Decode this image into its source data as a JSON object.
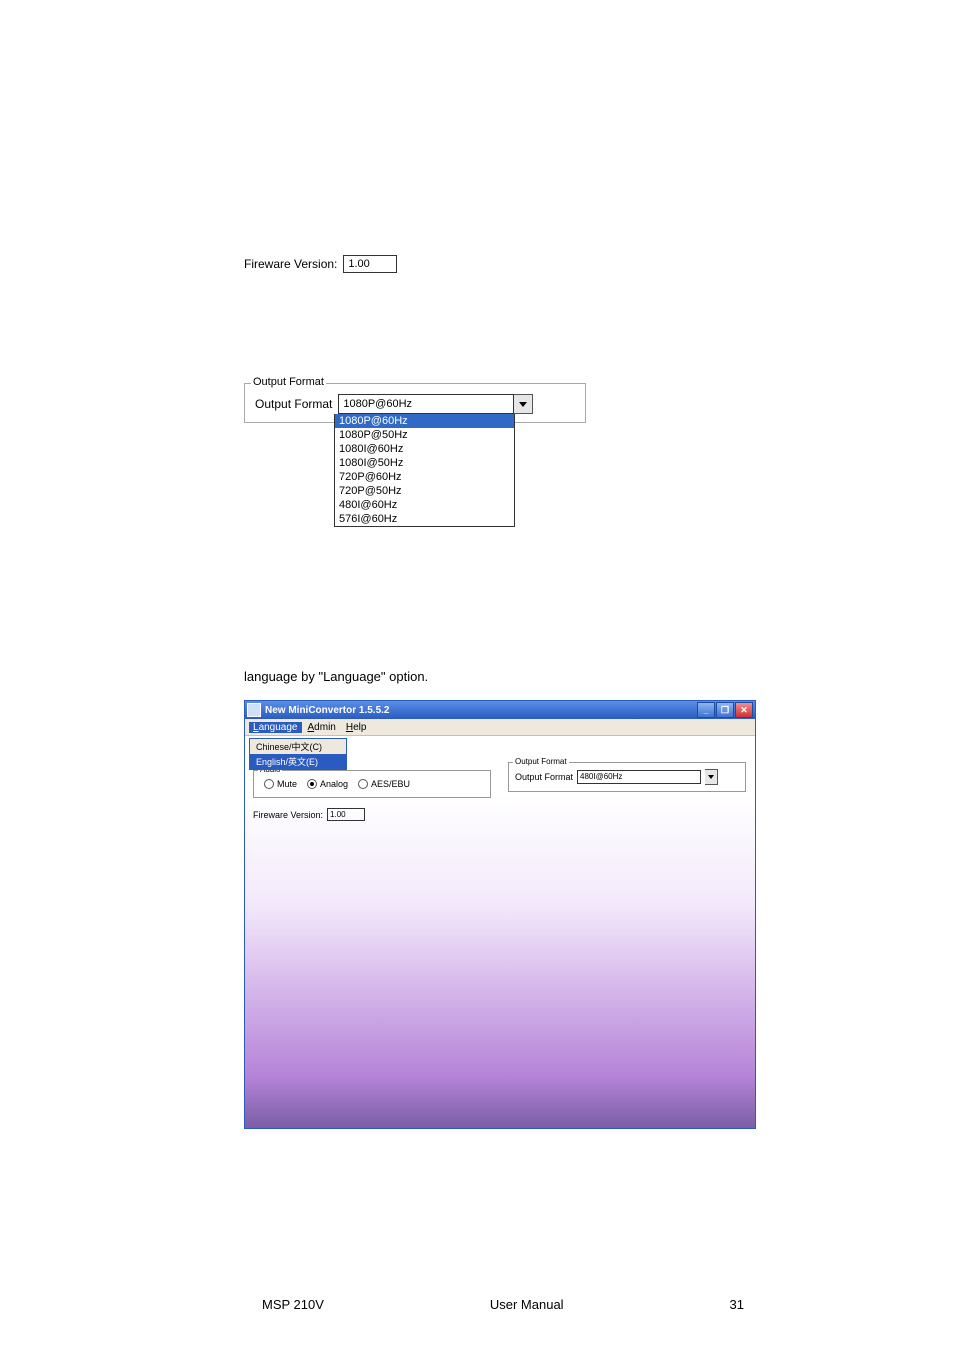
{
  "fireware": {
    "label": "Fireware Version:",
    "value": "1.00"
  },
  "output_format": {
    "legend": "Output Format",
    "label": "Output Format",
    "selected": "1080P@60Hz",
    "options": [
      "1080P@60Hz",
      "1080P@50Hz",
      "1080I@60Hz",
      "1080I@50Hz",
      "720P@60Hz",
      "720P@50Hz",
      "480I@60Hz",
      "576I@60Hz"
    ]
  },
  "sentence": "language by \"Language\" option.",
  "app": {
    "title": "New MiniConvertor 1.5.5.2",
    "menus": {
      "language": {
        "label": "Language",
        "u": "L"
      },
      "admin": {
        "label": "Admin",
        "u": "A"
      },
      "help": {
        "label": "Help",
        "u": "H"
      },
      "language_items": [
        "Chinese/中文(C)",
        "English/英文(E)"
      ]
    },
    "audio": {
      "legend": "Audio",
      "mute": "Mute",
      "analog": "Analog",
      "aes": "AES/EBU"
    },
    "out2": {
      "legend": "Output Format",
      "label": "Output Format",
      "selected": "480I@60Hz"
    },
    "fw": {
      "label": "Fireware Version:",
      "value": "1.00"
    },
    "winbtns": {
      "min": "_",
      "max": "❐",
      "close": "✕"
    }
  },
  "footer": {
    "left": "MSP 210V",
    "center": "User Manual",
    "right": "31"
  }
}
